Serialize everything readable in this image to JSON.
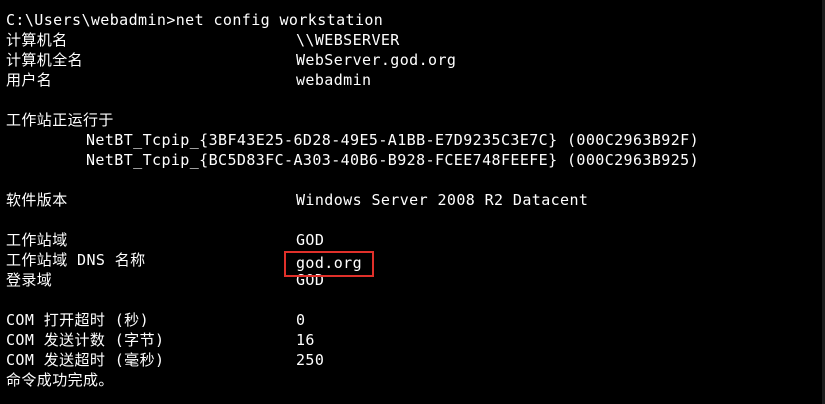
{
  "console": {
    "command": "C:\\Users\\webadmin>net config workstation",
    "rows": [
      {
        "label": "计算机名",
        "value": "\\\\WEBSERVER"
      },
      {
        "label": "计算机全名",
        "value": "WebServer.god.org"
      },
      {
        "label": "用户名",
        "value": "webadmin"
      }
    ],
    "active_on_label": "工作站正运行于",
    "transports": [
      "NetBT_Tcpip_{3BF43E25-6D28-49E5-A1BB-E7D9235C3E7C} (000C2963B92F)",
      "NetBT_Tcpip_{BC5D83FC-A303-40B6-B928-FCEE748FEEFE} (000C2963B925)"
    ],
    "software_version": {
      "label": "软件版本",
      "value": "Windows Server 2008 R2 Datacent"
    },
    "domain_rows": [
      {
        "label": "工作站域",
        "value": "GOD"
      },
      {
        "label": "工作站域 DNS 名称",
        "value": "god.org"
      },
      {
        "label": "登录域",
        "value": "GOD"
      }
    ],
    "com_rows": [
      {
        "label": "COM 打开超时 (秒)",
        "value": "0"
      },
      {
        "label": "COM 发送计数 (字节)",
        "value": "16"
      },
      {
        "label": "COM 发送超时 (毫秒)",
        "value": "250"
      }
    ],
    "completion": "命令成功完成。",
    "colors": {
      "background": "#000000",
      "text": "#ffffff",
      "highlight_border": "#e0302a"
    }
  }
}
